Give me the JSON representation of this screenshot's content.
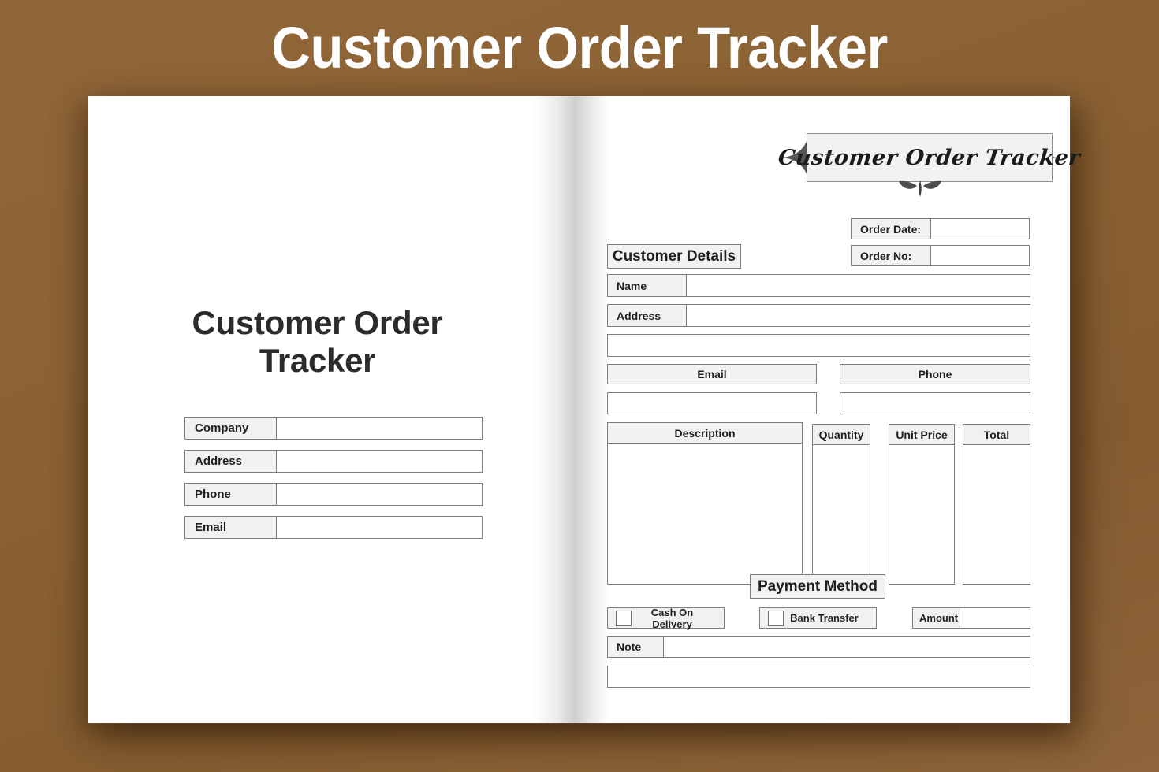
{
  "header": {
    "title": "Customer Order Tracker"
  },
  "colors": {
    "background_brown": "#8b6234",
    "page_white": "#ffffff",
    "field_shade": "#f1f1f1",
    "border": "#7d7d7d",
    "text_dark": "#1f1f1f",
    "ornament_dark": "#555555"
  },
  "left_page": {
    "title": "Customer Order Tracker",
    "fields": [
      {
        "label": "Company",
        "value": ""
      },
      {
        "label": "Address",
        "value": ""
      },
      {
        "label": "Phone",
        "value": ""
      },
      {
        "label": "Email",
        "value": ""
      }
    ]
  },
  "right_page": {
    "logo_text": "Customer Order Tracker",
    "section_customer_details": "Customer Details",
    "order_meta": [
      {
        "label": "Order Date:",
        "value": ""
      },
      {
        "label": "Order No:",
        "value": ""
      }
    ],
    "customer_fields": [
      {
        "label": "Name",
        "value": ""
      },
      {
        "label": "Address",
        "value": ""
      }
    ],
    "address_line2": "",
    "contact": [
      {
        "label": "Email",
        "value": ""
      },
      {
        "label": "Phone",
        "value": ""
      }
    ],
    "table": {
      "columns": [
        "Description",
        "Quantity",
        "Unit Price",
        "Total"
      ],
      "rows": []
    },
    "section_payment_method": "Payment Method",
    "payment_options": [
      {
        "label": "Cash On Delivery",
        "checked": false
      },
      {
        "label": "Bank Transfer",
        "checked": false
      }
    ],
    "amount": {
      "label": "Amount",
      "value": ""
    },
    "note": {
      "label": "Note",
      "value": ""
    },
    "note_line2": ""
  }
}
